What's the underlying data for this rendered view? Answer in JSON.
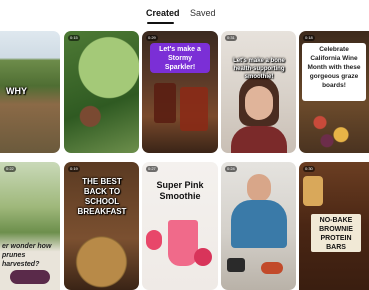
{
  "tabs": {
    "created": "Created",
    "saved": "Saved"
  },
  "pins_row1": [
    {
      "caption": "WHY"
    },
    {
      "caption": ""
    },
    {
      "badge": "0:29",
      "caption": "Let's make a Stormy Sparkler!"
    },
    {
      "badge": "0:31",
      "caption": "Let's make a bone health-supporting smoothie!"
    },
    {
      "badge": "0:18",
      "caption": "Celebrate California Wine Month with these gorgeous graze boards!"
    }
  ],
  "pins_row2": [
    {
      "badge": "0:22",
      "caption": "er wonder how prunes harvested?"
    },
    {
      "badge": "0:19",
      "caption": "THE BEST BACK TO SCHOOL BREAKFAST"
    },
    {
      "badge": "0:27",
      "caption": "Super Pink Smoothie"
    },
    {
      "badge": "0:24",
      "caption": ""
    },
    {
      "badge": "0:30",
      "caption": "NO-BAKE BROWNIE PROTEIN BARS"
    }
  ]
}
